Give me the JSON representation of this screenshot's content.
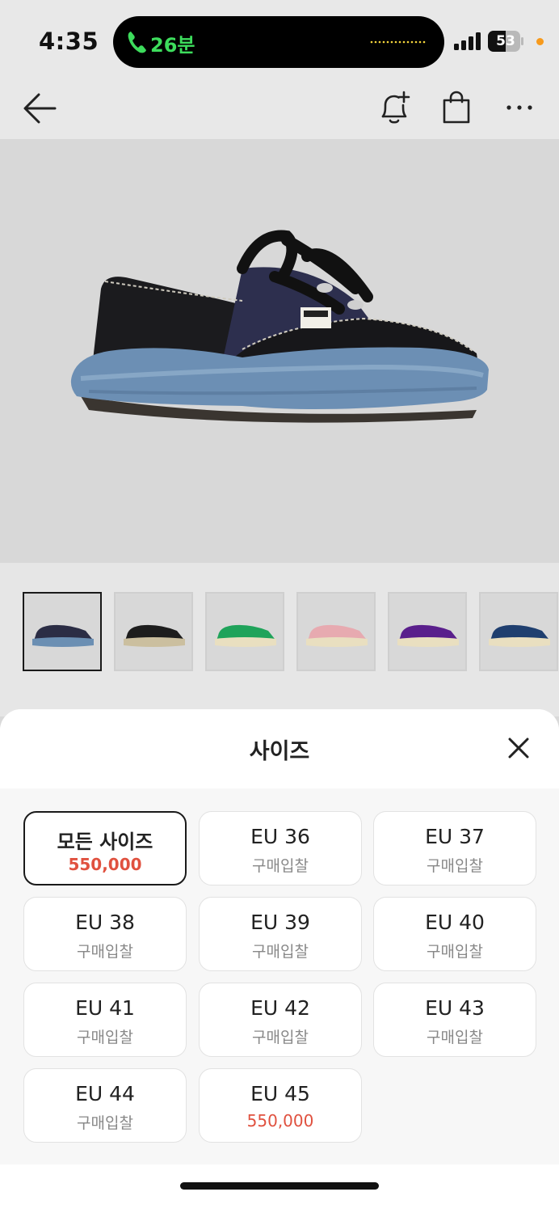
{
  "status_bar": {
    "time": "4:35",
    "call_duration": "26분",
    "battery_level": "53",
    "call_color": "#3ddc5c"
  },
  "nav": {
    "icons": [
      "back-arrow-icon",
      "bell-plus-icon",
      "shopping-bag-icon",
      "more-icon"
    ]
  },
  "thumbnails": [
    {
      "color": "navy-black",
      "upper": "#2b2d45",
      "sole": "#6b8fb3",
      "selected": true
    },
    {
      "color": "black",
      "upper": "#1d1d1d",
      "sole": "#cbbf9f",
      "selected": false
    },
    {
      "color": "green",
      "upper": "#1fa35a",
      "sole": "#e9dfc0",
      "selected": false
    },
    {
      "color": "pink",
      "upper": "#e7aab0",
      "sole": "#e9dfc0",
      "selected": false
    },
    {
      "color": "purple",
      "upper": "#5a1f8c",
      "sole": "#e9dfc0",
      "selected": false
    },
    {
      "color": "blue",
      "upper": "#1f3f6f",
      "sole": "#e9dfc0",
      "selected": false
    }
  ],
  "sheet": {
    "title": "사이즈",
    "accent": "#e0513f",
    "sizes": [
      {
        "label": "모든 사이즈",
        "sub": "550,000",
        "type": "price",
        "selected": true
      },
      {
        "label": "EU 36",
        "sub": "구매입찰",
        "type": "bid",
        "selected": false
      },
      {
        "label": "EU 37",
        "sub": "구매입찰",
        "type": "bid",
        "selected": false
      },
      {
        "label": "EU 38",
        "sub": "구매입찰",
        "type": "bid",
        "selected": false
      },
      {
        "label": "EU 39",
        "sub": "구매입찰",
        "type": "bid",
        "selected": false
      },
      {
        "label": "EU 40",
        "sub": "구매입찰",
        "type": "bid",
        "selected": false
      },
      {
        "label": "EU 41",
        "sub": "구매입찰",
        "type": "bid",
        "selected": false
      },
      {
        "label": "EU 42",
        "sub": "구매입찰",
        "type": "bid",
        "selected": false
      },
      {
        "label": "EU 43",
        "sub": "구매입찰",
        "type": "bid",
        "selected": false
      },
      {
        "label": "EU 44",
        "sub": "구매입찰",
        "type": "bid",
        "selected": false
      },
      {
        "label": "EU 45",
        "sub": "550,000",
        "type": "price-light",
        "selected": false
      }
    ]
  }
}
